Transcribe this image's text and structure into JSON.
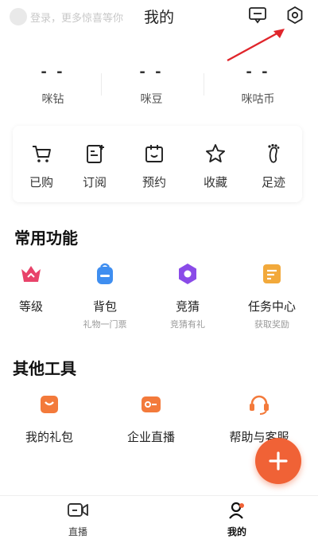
{
  "header": {
    "login_hint": "登录，更多惊喜等你",
    "title": "我的"
  },
  "stats": [
    {
      "value": "- -",
      "label": "咪钻"
    },
    {
      "value": "- -",
      "label": "咪豆"
    },
    {
      "value": "- -",
      "label": "咪咕币"
    }
  ],
  "quick": [
    {
      "label": "已购",
      "icon": "cart-icon"
    },
    {
      "label": "订阅",
      "icon": "subscribe-icon"
    },
    {
      "label": "预约",
      "icon": "calendar-icon"
    },
    {
      "label": "收藏",
      "icon": "star-icon"
    },
    {
      "label": "足迹",
      "icon": "footprint-icon"
    }
  ],
  "common": {
    "title": "常用功能",
    "items": [
      {
        "label": "等级",
        "sub": "",
        "icon": "crown-icon"
      },
      {
        "label": "背包",
        "sub": "礼物一门票",
        "icon": "backpack-icon"
      },
      {
        "label": "竞猜",
        "sub": "竞猜有礼",
        "icon": "hexagon-icon"
      },
      {
        "label": "任务中心",
        "sub": "获取奖励",
        "icon": "task-icon"
      }
    ]
  },
  "tools": {
    "title": "其他工具",
    "items": [
      {
        "label": "我的礼包",
        "icon": "gift-bag-icon"
      },
      {
        "label": "企业直播",
        "icon": "enterprise-live-icon"
      },
      {
        "label": "帮助与客服",
        "icon": "headset-icon"
      }
    ]
  },
  "nav": [
    {
      "label": "直播",
      "icon": "live-icon"
    },
    {
      "label": "我的",
      "icon": "profile-icon"
    }
  ],
  "colors": {
    "accent": "#f06236",
    "crown": "#e8436a",
    "backpack": "#3f8ef0",
    "hexagon": "#8a4be8",
    "task": "#f2a93b",
    "gift": "#f37a3b",
    "arrow": "#e0252b"
  }
}
